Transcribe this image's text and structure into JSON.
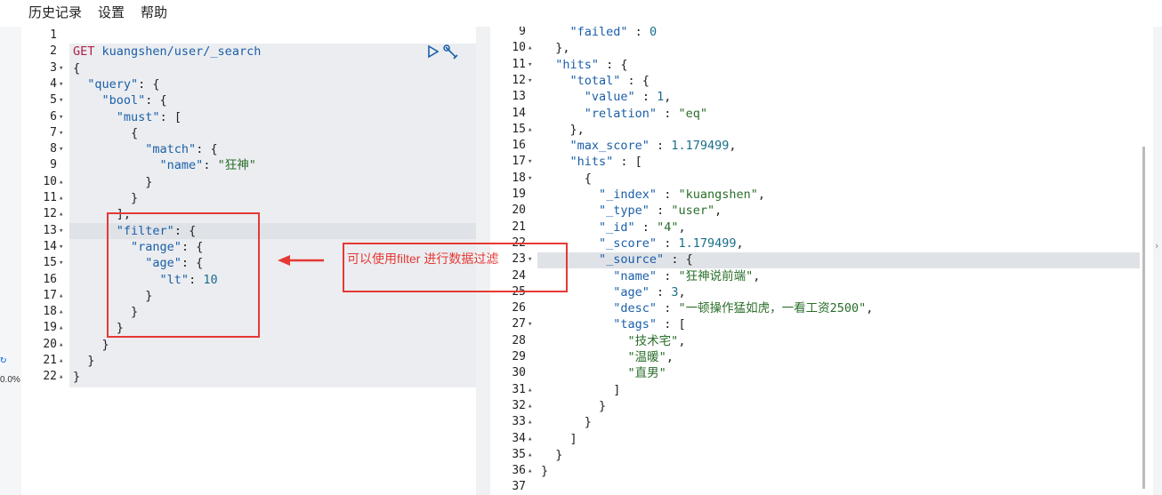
{
  "menu": {
    "history": "历史记录",
    "settings": "设置",
    "help": "帮助"
  },
  "sidebar": {
    "close": "×",
    "percent": "0.0%"
  },
  "callout": {
    "text": "可以使用filter 进行数据过滤"
  },
  "request": {
    "lines": [
      {
        "n": "1",
        "fold": "",
        "segs": []
      },
      {
        "n": "2",
        "fold": "",
        "segs": [
          [
            "m",
            "GET "
          ],
          [
            "k",
            "kuangshen/user/_search"
          ]
        ]
      },
      {
        "n": "3",
        "fold": "▾",
        "segs": [
          [
            "p",
            "{"
          ]
        ]
      },
      {
        "n": "4",
        "fold": "▾",
        "segs": [
          [
            "p",
            "  "
          ],
          [
            "k",
            "\"query\""
          ],
          [
            "p",
            ": {"
          ]
        ]
      },
      {
        "n": "5",
        "fold": "▾",
        "segs": [
          [
            "p",
            "    "
          ],
          [
            "k",
            "\"bool\""
          ],
          [
            "p",
            ": {"
          ]
        ]
      },
      {
        "n": "6",
        "fold": "▾",
        "segs": [
          [
            "p",
            "      "
          ],
          [
            "k",
            "\"must\""
          ],
          [
            "p",
            ": ["
          ]
        ]
      },
      {
        "n": "7",
        "fold": "▾",
        "segs": [
          [
            "p",
            "        {"
          ]
        ]
      },
      {
        "n": "8",
        "fold": "▾",
        "segs": [
          [
            "p",
            "          "
          ],
          [
            "k",
            "\"match\""
          ],
          [
            "p",
            ": {"
          ]
        ]
      },
      {
        "n": "9",
        "fold": "",
        "segs": [
          [
            "p",
            "            "
          ],
          [
            "k",
            "\"name\""
          ],
          [
            "p",
            ": "
          ],
          [
            "s",
            "\"狂神\""
          ]
        ]
      },
      {
        "n": "10",
        "fold": "▴",
        "segs": [
          [
            "p",
            "          }"
          ]
        ]
      },
      {
        "n": "11",
        "fold": "▴",
        "segs": [
          [
            "p",
            "        }"
          ]
        ]
      },
      {
        "n": "12",
        "fold": "▴",
        "segs": [
          [
            "p",
            "      ],"
          ]
        ]
      },
      {
        "n": "13",
        "fold": "▾",
        "segs": [
          [
            "p",
            "      "
          ],
          [
            "k",
            "\"filter\""
          ],
          [
            "p",
            ": {"
          ]
        ]
      },
      {
        "n": "14",
        "fold": "▾",
        "segs": [
          [
            "p",
            "        "
          ],
          [
            "k",
            "\"range\""
          ],
          [
            "p",
            ": {"
          ]
        ]
      },
      {
        "n": "15",
        "fold": "▾",
        "segs": [
          [
            "p",
            "          "
          ],
          [
            "k",
            "\"age\""
          ],
          [
            "p",
            ": {"
          ]
        ]
      },
      {
        "n": "16",
        "fold": "",
        "segs": [
          [
            "p",
            "            "
          ],
          [
            "k",
            "\"lt\""
          ],
          [
            "p",
            ": "
          ],
          [
            "n",
            "10"
          ]
        ]
      },
      {
        "n": "17",
        "fold": "▴",
        "segs": [
          [
            "p",
            "          }"
          ]
        ]
      },
      {
        "n": "18",
        "fold": "▴",
        "segs": [
          [
            "p",
            "        }"
          ]
        ]
      },
      {
        "n": "19",
        "fold": "▴",
        "segs": [
          [
            "p",
            "      }"
          ]
        ]
      },
      {
        "n": "20",
        "fold": "▴",
        "segs": [
          [
            "p",
            "    }"
          ]
        ]
      },
      {
        "n": "21",
        "fold": "▴",
        "segs": [
          [
            "p",
            "  }"
          ]
        ]
      },
      {
        "n": "22",
        "fold": "▴",
        "segs": [
          [
            "p",
            "}"
          ]
        ]
      }
    ]
  },
  "response": {
    "lines": [
      {
        "n": "9",
        "fold": "",
        "segs": [
          [
            "p",
            "    "
          ],
          [
            "k",
            "\"failed\""
          ],
          [
            "p",
            " : "
          ],
          [
            "n",
            "0"
          ]
        ]
      },
      {
        "n": "10",
        "fold": "▴",
        "segs": [
          [
            "p",
            "  },"
          ]
        ]
      },
      {
        "n": "11",
        "fold": "▾",
        "segs": [
          [
            "p",
            "  "
          ],
          [
            "k",
            "\"hits\""
          ],
          [
            "p",
            " : {"
          ]
        ]
      },
      {
        "n": "12",
        "fold": "▾",
        "segs": [
          [
            "p",
            "    "
          ],
          [
            "k",
            "\"total\""
          ],
          [
            "p",
            " : {"
          ]
        ]
      },
      {
        "n": "13",
        "fold": "",
        "segs": [
          [
            "p",
            "      "
          ],
          [
            "k",
            "\"value\""
          ],
          [
            "p",
            " : "
          ],
          [
            "n",
            "1"
          ],
          [
            "p",
            ","
          ]
        ]
      },
      {
        "n": "14",
        "fold": "",
        "segs": [
          [
            "p",
            "      "
          ],
          [
            "k",
            "\"relation\""
          ],
          [
            "p",
            " : "
          ],
          [
            "s",
            "\"eq\""
          ]
        ]
      },
      {
        "n": "15",
        "fold": "▴",
        "segs": [
          [
            "p",
            "    },"
          ]
        ]
      },
      {
        "n": "16",
        "fold": "",
        "segs": [
          [
            "p",
            "    "
          ],
          [
            "k",
            "\"max_score\""
          ],
          [
            "p",
            " : "
          ],
          [
            "n",
            "1.179499"
          ],
          [
            "p",
            ","
          ]
        ]
      },
      {
        "n": "17",
        "fold": "▾",
        "segs": [
          [
            "p",
            "    "
          ],
          [
            "k",
            "\"hits\""
          ],
          [
            "p",
            " : ["
          ]
        ]
      },
      {
        "n": "18",
        "fold": "▾",
        "segs": [
          [
            "p",
            "      {"
          ]
        ]
      },
      {
        "n": "19",
        "fold": "",
        "segs": [
          [
            "p",
            "        "
          ],
          [
            "k",
            "\"_index\""
          ],
          [
            "p",
            " : "
          ],
          [
            "s",
            "\"kuangshen\""
          ],
          [
            "p",
            ","
          ]
        ]
      },
      {
        "n": "20",
        "fold": "",
        "segs": [
          [
            "p",
            "        "
          ],
          [
            "k",
            "\"_type\""
          ],
          [
            "p",
            " : "
          ],
          [
            "s",
            "\"user\""
          ],
          [
            "p",
            ","
          ]
        ]
      },
      {
        "n": "21",
        "fold": "",
        "segs": [
          [
            "p",
            "        "
          ],
          [
            "k",
            "\"_id\""
          ],
          [
            "p",
            " : "
          ],
          [
            "s",
            "\"4\""
          ],
          [
            "p",
            ","
          ]
        ]
      },
      {
        "n": "22",
        "fold": "",
        "segs": [
          [
            "p",
            "        "
          ],
          [
            "k",
            "\"_score\""
          ],
          [
            "p",
            " : "
          ],
          [
            "n",
            "1.179499"
          ],
          [
            "p",
            ","
          ]
        ]
      },
      {
        "n": "23",
        "fold": "▾",
        "segs": [
          [
            "p",
            "        "
          ],
          [
            "k",
            "\"_source\""
          ],
          [
            "p",
            " : {"
          ]
        ]
      },
      {
        "n": "24",
        "fold": "",
        "segs": [
          [
            "p",
            "          "
          ],
          [
            "k",
            "\"name\""
          ],
          [
            "p",
            " : "
          ],
          [
            "s",
            "\"狂神说前端\""
          ],
          [
            "p",
            ","
          ]
        ]
      },
      {
        "n": "25",
        "fold": "",
        "segs": [
          [
            "p",
            "          "
          ],
          [
            "k",
            "\"age\""
          ],
          [
            "p",
            " : "
          ],
          [
            "n",
            "3"
          ],
          [
            "p",
            ","
          ]
        ]
      },
      {
        "n": "26",
        "fold": "",
        "segs": [
          [
            "p",
            "          "
          ],
          [
            "k",
            "\"desc\""
          ],
          [
            "p",
            " : "
          ],
          [
            "s",
            "\"一顿操作猛如虎，一看工资2500\""
          ],
          [
            "p",
            ","
          ]
        ]
      },
      {
        "n": "27",
        "fold": "▾",
        "segs": [
          [
            "p",
            "          "
          ],
          [
            "k",
            "\"tags\""
          ],
          [
            "p",
            " : ["
          ]
        ]
      },
      {
        "n": "28",
        "fold": "",
        "segs": [
          [
            "p",
            "            "
          ],
          [
            "s",
            "\"技术宅\""
          ],
          [
            "p",
            ","
          ]
        ]
      },
      {
        "n": "29",
        "fold": "",
        "segs": [
          [
            "p",
            "            "
          ],
          [
            "s",
            "\"温暖\""
          ],
          [
            "p",
            ","
          ]
        ]
      },
      {
        "n": "30",
        "fold": "",
        "segs": [
          [
            "p",
            "            "
          ],
          [
            "s",
            "\"直男\""
          ]
        ]
      },
      {
        "n": "31",
        "fold": "▴",
        "segs": [
          [
            "p",
            "          ]"
          ]
        ]
      },
      {
        "n": "32",
        "fold": "▴",
        "segs": [
          [
            "p",
            "        }"
          ]
        ]
      },
      {
        "n": "33",
        "fold": "▴",
        "segs": [
          [
            "p",
            "      }"
          ]
        ]
      },
      {
        "n": "34",
        "fold": "▴",
        "segs": [
          [
            "p",
            "    ]"
          ]
        ]
      },
      {
        "n": "35",
        "fold": "▴",
        "segs": [
          [
            "p",
            "  }"
          ]
        ]
      },
      {
        "n": "36",
        "fold": "▴",
        "segs": [
          [
            "p",
            "}"
          ]
        ]
      },
      {
        "n": "37",
        "fold": "",
        "segs": []
      }
    ]
  },
  "colors": {
    "accent": "#e53935",
    "key": "#1a5fa8",
    "string": "#2a6e2a",
    "method": "#b0204a"
  },
  "icons": {
    "run": "play-icon",
    "wrench": "wrench-icon",
    "sidebar": "refresh-icon",
    "close": "close-icon"
  }
}
